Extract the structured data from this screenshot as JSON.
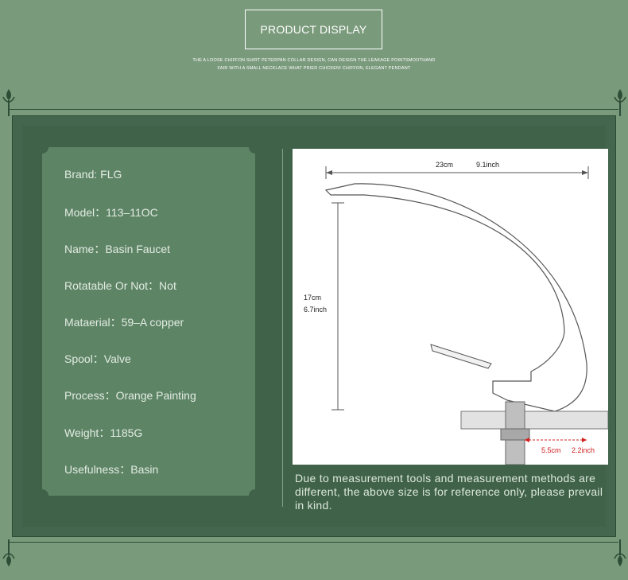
{
  "header": {
    "title": "PRODUCT DISPLAY",
    "subtitle_line1": "THE A LOOSE CHIFFON SHIRT PETERPAN COLLAR DESIGN, CAN DESIGN THE LEAKAGE POINTSMOOTHAND",
    "subtitle_line2": "FAIR WITH A SMALL NECKLACE WHAT PRIED CHICKEN! CHIFFON, ELEGANT PENDANT"
  },
  "specs": [
    {
      "text": "Brand:  FLG"
    },
    {
      "text": "Model：113–11OC"
    },
    {
      "text": "Name：Basin Faucet"
    },
    {
      "text": "Rotatable Or Not：Not"
    },
    {
      "text": "Mataerial：59–A copper"
    },
    {
      "text": "Spool：Valve"
    },
    {
      "text": "Process：Orange Painting"
    },
    {
      "text": "Weight：1185G"
    },
    {
      "text": "Usefulness：Basin"
    }
  ],
  "diagram": {
    "width_cm": "23cm",
    "width_inch": "9.1inch",
    "height_cm": "17cm",
    "height_inch": "6.7inch",
    "base_cm": "5.5cm",
    "base_inch": "2.2inch"
  },
  "note": "Due to measurement tools and measurement methods are different, the above size is for reference only, please prevail in kind.",
  "colors": {
    "background": "#7a9a7c",
    "panel": "#3f6248",
    "card": "#5e8466",
    "accent_red": "#d0201f"
  }
}
